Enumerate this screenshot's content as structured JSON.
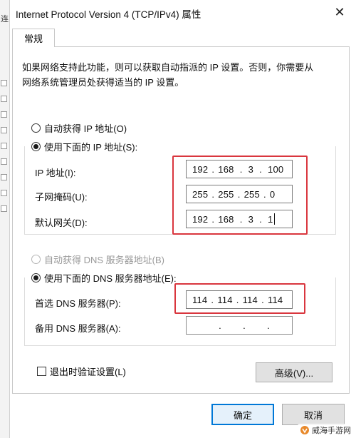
{
  "dialog": {
    "title": "Internet Protocol Version 4 (TCP/IPv4) 属性",
    "close_glyph": "✕",
    "tab_general": "常规",
    "description": "如果网络支持此功能，则可以获取自动指派的 IP 设置。否则，你需要从网络系统管理员处获得适当的 IP 设置。"
  },
  "ip": {
    "auto_label": "自动获得 IP 地址(O)",
    "manual_label": "使用下面的 IP 地址(S):",
    "selected": "manual",
    "address_label": "IP 地址(I):",
    "address": [
      "192",
      "168",
      "3",
      "100"
    ],
    "subnet_label": "子网掩码(U):",
    "subnet": [
      "255",
      "255",
      "255",
      "0"
    ],
    "gateway_label": "默认网关(D):",
    "gateway": [
      "192",
      "168",
      "3",
      "1"
    ]
  },
  "dns": {
    "auto_label": "自动获得 DNS 服务器地址(B)",
    "auto_disabled": true,
    "manual_label": "使用下面的 DNS 服务器地址(E):",
    "selected": "manual",
    "preferred_label": "首选 DNS 服务器(P):",
    "preferred": [
      "114",
      "114",
      "114",
      "114"
    ],
    "alternate_label": "备用 DNS 服务器(A):",
    "alternate": [
      "",
      "",
      "",
      ""
    ]
  },
  "options": {
    "validate_label": "退出时验证设置(L)",
    "validate_checked": false,
    "advanced_label": "高级(V)..."
  },
  "footer": {
    "ok_label": "确定",
    "cancel_label": "取消"
  },
  "watermark": {
    "text": "威海手游网"
  },
  "colors": {
    "highlight_red": "#d9363e",
    "default_button_border": "#0078d7"
  }
}
